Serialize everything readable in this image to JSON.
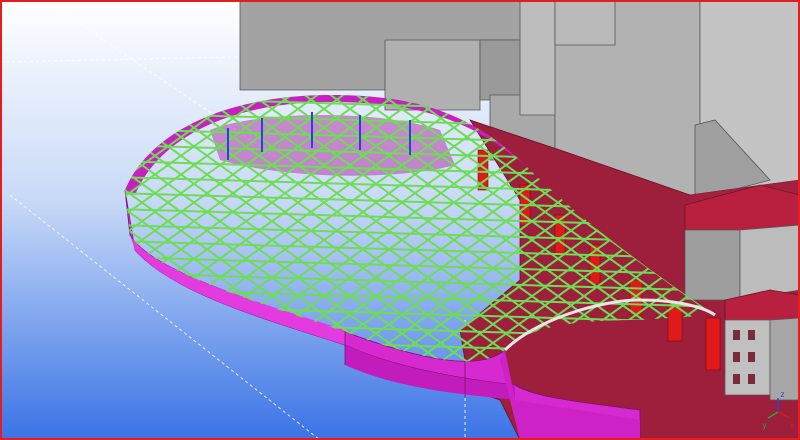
{
  "viewport": {
    "colors": {
      "frame": "#e41e1e",
      "sky_top": "#ffffff",
      "sky_bottom": "#3a73e6",
      "building": "#a8a8a8",
      "building_shadow": "#8e8e8e",
      "floor_slab": "#9b1f3a",
      "parapet": "#d41fc9",
      "grid_members": "#6fdc56",
      "columns": "#e01a1a",
      "roof_tiles": "#b8203f"
    },
    "axis_indicator": {
      "x_label": "x",
      "y_label": "y",
      "z_label": "z"
    }
  }
}
